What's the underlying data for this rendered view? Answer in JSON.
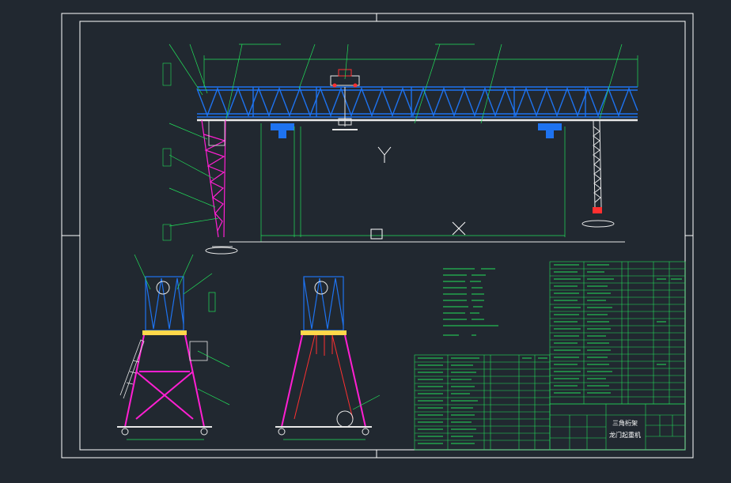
{
  "drawing": {
    "title_line1": "三角桁架",
    "title_line2": "龙门起重机"
  },
  "colors": {
    "background": "#212830",
    "frame": "#ffffff",
    "truss": "#1e73f0",
    "leg": "#ff1fd2",
    "leader": "#22e05a",
    "table": "#22e05a",
    "dimension": "#22e05a",
    "rail": "#ffd84a",
    "hook": "#ff3030",
    "centerline": "#ffffff"
  },
  "icons": [
    "crosshair-symbol",
    "y-axis-symbol",
    "ucs-square-symbol"
  ]
}
